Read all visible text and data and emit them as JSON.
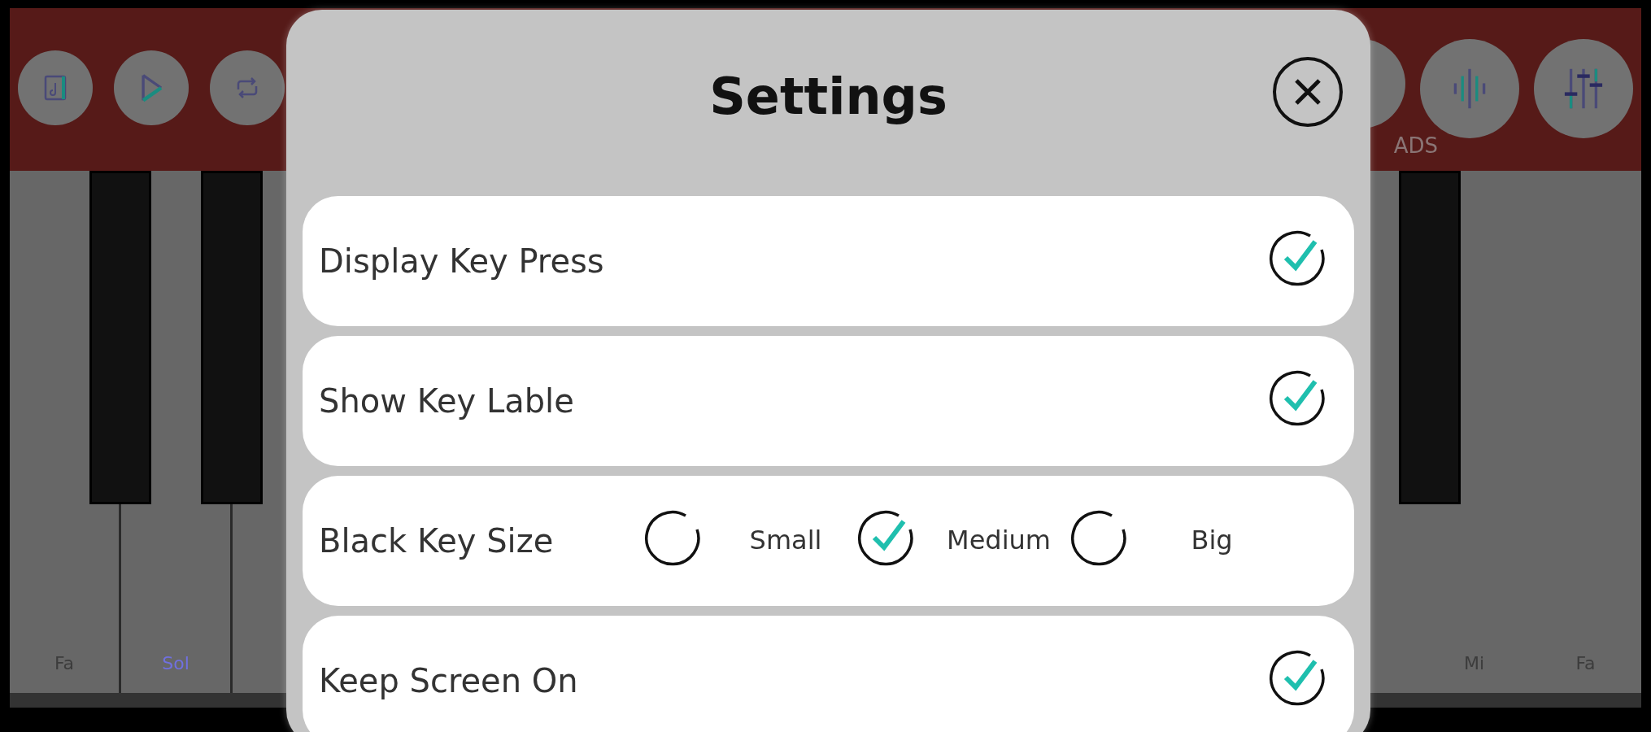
{
  "toolbar": {
    "left_buttons": [
      {
        "kind": "score"
      },
      {
        "kind": "play"
      },
      {
        "kind": "loop"
      }
    ],
    "right_buttons": [
      {
        "kind": "hidden"
      },
      {
        "kind": "wave"
      },
      {
        "kind": "mixer"
      }
    ],
    "ads_label": "ADS"
  },
  "keyboard": {
    "left_labels": [
      {
        "text": "Fa",
        "color": "#3c3c3c"
      },
      {
        "text": "Sol",
        "color": "#7070e0"
      }
    ],
    "right_labels": [
      {
        "text": "Mi",
        "color": "#3c3c3c"
      },
      {
        "text": "Fa",
        "color": "#3c3c3c"
      }
    ]
  },
  "dialog": {
    "title": "Settings",
    "rows": [
      {
        "kind": "toggle",
        "label": "Display Key Press",
        "checked": true
      },
      {
        "kind": "toggle",
        "label": "Show Key Lable",
        "checked": true
      },
      {
        "kind": "choice",
        "label": "Black Key Size",
        "options": [
          {
            "label": "Small",
            "selected": false
          },
          {
            "label": "Medium",
            "selected": true
          },
          {
            "label": "Big",
            "selected": false
          }
        ]
      },
      {
        "kind": "toggle",
        "label": "Keep Screen On",
        "checked": true
      }
    ]
  }
}
